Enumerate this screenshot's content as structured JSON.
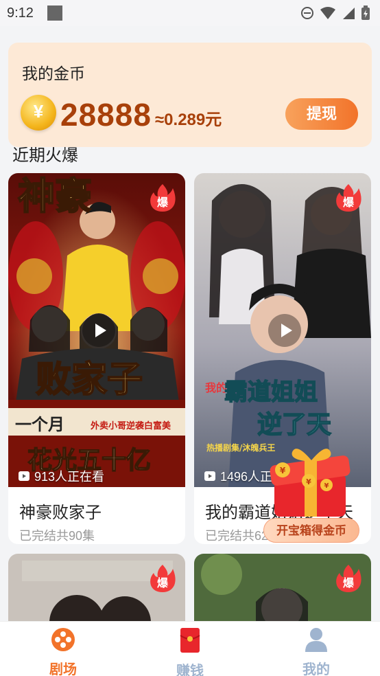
{
  "status_bar": {
    "time": "9:12"
  },
  "coins": {
    "title": "我的金币",
    "coin_symbol": "¥",
    "amount": "28888",
    "rate_text": "≈0.289元",
    "withdraw_label": "提现"
  },
  "section": {
    "title": "近期火爆"
  },
  "dramas": [
    {
      "poster_title_top": "神豪",
      "poster_title_main": "败家子",
      "poster_tagline_a": "一个月",
      "poster_tagline_b": "外卖小哥逆袭白富美",
      "poster_tagline_c": "花光五十亿",
      "badge": "爆",
      "watching": "913人正在看",
      "title": "神豪败家子",
      "subtitle": "已完结共90集"
    },
    {
      "poster_title_top": "我的",
      "poster_title_main": "霸道姐姐",
      "poster_title_sub": "逆了天",
      "poster_caption": "热播剧集/沐魄兵王",
      "badge": "爆",
      "watching": "1496人正在看",
      "title": "我的霸道姐姐逆了天",
      "subtitle": "已完结共62集"
    }
  ],
  "more_dramas": [
    {
      "badge": "爆"
    },
    {
      "badge": "爆"
    }
  ],
  "treasure": {
    "label": "开宝箱得金币",
    "coin_symbol": "¥"
  },
  "nav": [
    {
      "label": "剧场",
      "active": true
    },
    {
      "label": "赚钱",
      "active": false
    },
    {
      "label": "我的",
      "active": false
    }
  ],
  "colors": {
    "accent": "#f2732a",
    "nav_active": "#f2732a",
    "nav_inactive": "#9fb4cf",
    "coin_text": "#a8400a"
  }
}
